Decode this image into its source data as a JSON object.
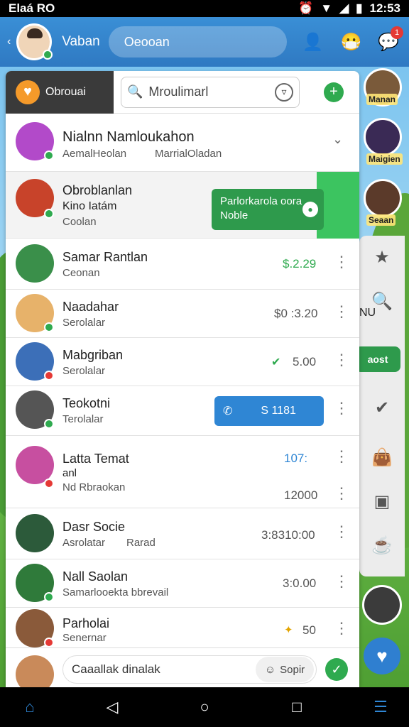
{
  "status_bar": {
    "carrier": "Elaá RO",
    "time": "12:53"
  },
  "header": {
    "username": "Vaban",
    "search_text": "Oeooan",
    "notif_count": "1"
  },
  "tab": {
    "label": "Obrouai"
  },
  "search": {
    "text": "Mroulimarl"
  },
  "chats": [
    {
      "name": "Nialnn Namloukahon",
      "preview": "AemalHeolan",
      "extra": "MarrialOladan"
    },
    {
      "name": "Obroblanlan",
      "line2": "Kino Iatám",
      "preview": "Coolan"
    },
    {
      "name": "Samar Rantlan",
      "preview": "Ceonan",
      "value": "$.2.29"
    },
    {
      "name": "Naadahar",
      "preview": "Serolalar",
      "value": "$0 :3.20"
    },
    {
      "name": "Mabgriban",
      "preview": "Serolalar",
      "value": "5.00"
    },
    {
      "name": "Teokotni",
      "preview": "Terolalar"
    },
    {
      "name": "Latta Temat",
      "line2": "anl",
      "preview": "Nd Rbraokan",
      "value": "107:",
      "value2": "12000"
    },
    {
      "name": "Dasr Socie",
      "preview": "Asrolatar",
      "extra": "Rarad",
      "value": "3:8310:00"
    },
    {
      "name": "Nall Saolan",
      "preview": "Samarlooekta bbrevail",
      "value": "3:0.00"
    },
    {
      "name": "Parholai",
      "preview": "Senernar",
      "value": "50"
    }
  ],
  "popup_green": {
    "line1": "Parlorkarola oora",
    "line2": "Noble"
  },
  "popup_blue": {
    "text": "S 1181"
  },
  "right_rail": {
    "label1": "Manan",
    "label2": "Maigien",
    "label3": "Seaan",
    "partial": "NU",
    "bubble": "aost"
  },
  "composer": {
    "placeholder": "Caaallak dinalak",
    "emoji_label": "Sopir"
  },
  "colors": {
    "header_blue": "#2f79c2",
    "accent_green": "#2faa4f",
    "popup_blue": "#2f86d4",
    "orange": "#f59a2a"
  }
}
